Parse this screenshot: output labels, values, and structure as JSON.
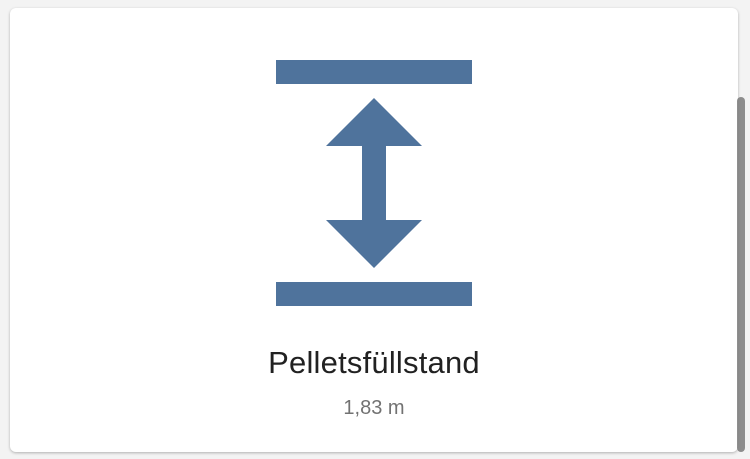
{
  "card": {
    "name": "Pelletsfüllstand",
    "state": "1,83 m",
    "icon": "arrow-expand-vertical-icon"
  },
  "colors": {
    "icon": "#4f739c",
    "card_background": "#ffffff",
    "name_text": "#212121",
    "state_text": "#727272"
  }
}
